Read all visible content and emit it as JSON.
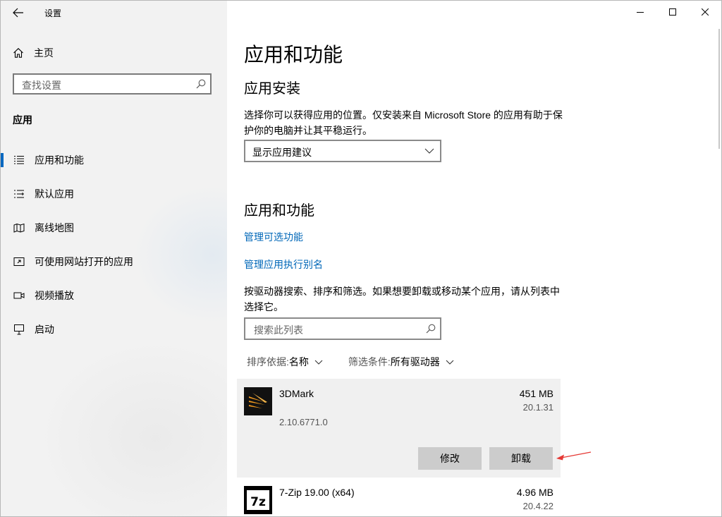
{
  "window": {
    "title": "设置",
    "controls": {
      "minimize": "minimize-icon",
      "maximize": "maximize-icon",
      "close": "close-icon"
    }
  },
  "sidebar": {
    "home_label": "主页",
    "search_placeholder": "查找设置",
    "section_title": "应用",
    "items": [
      {
        "label": "应用和功能",
        "icon": "apps-list-icon",
        "active": true
      },
      {
        "label": "默认应用",
        "icon": "default-apps-icon",
        "active": false
      },
      {
        "label": "离线地图",
        "icon": "map-icon",
        "active": false
      },
      {
        "label": "可使用网站打开的应用",
        "icon": "open-with-website-icon",
        "active": false
      },
      {
        "label": "视频播放",
        "icon": "video-icon",
        "active": false
      },
      {
        "label": "启动",
        "icon": "startup-icon",
        "active": false
      }
    ]
  },
  "main": {
    "title": "应用和功能",
    "install_heading": "应用安装",
    "install_description": "选择你可以获得应用的位置。仅安装来自 Microsoft Store 的应用有助于保护你的电脑并让其平稳运行。",
    "install_select_value": "显示应用建议",
    "apps_heading": "应用和功能",
    "link_optional_features": "管理可选功能",
    "link_execution_alias": "管理应用执行别名",
    "list_description": "按驱动器搜索、排序和筛选。如果想要卸载或移动某个应用，请从列表中选择它。",
    "list_search_placeholder": "搜索此列表",
    "sort_label": "排序依据:",
    "sort_value": "名称",
    "filter_label": "筛选条件:",
    "filter_value": "所有驱动器",
    "apps": [
      {
        "name": "3DMark",
        "size": "451 MB",
        "date": "20.1.31",
        "version": "2.10.6771.0",
        "selected": true
      },
      {
        "name": "7-Zip 19.00 (x64)",
        "size": "4.96 MB",
        "date": "20.4.22"
      }
    ],
    "modify_button": "修改",
    "uninstall_button": "卸载"
  },
  "colors": {
    "accent": "#0067c0",
    "link": "#0067b8",
    "arrow": "#e53935"
  }
}
